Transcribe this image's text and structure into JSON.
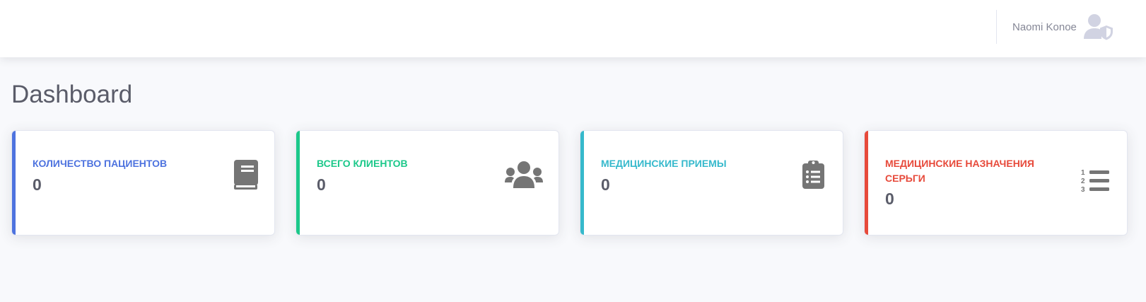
{
  "header": {
    "user_name": "Naomi Konoe",
    "user_icon": "user-shield-icon"
  },
  "page": {
    "title": "Dashboard"
  },
  "cards": [
    {
      "label": "КОЛИЧЕСТВО ПАЦИЕНТОВ",
      "value": "0",
      "color": "#4e73df",
      "icon": "book-icon"
    },
    {
      "label": "ВСЕГО КЛИЕНТОВ",
      "value": "0",
      "color": "#1cc88a",
      "icon": "users-icon"
    },
    {
      "label": "МЕДИЦИНСКИЕ ПРИЕМЫ",
      "value": "0",
      "color": "#36b9cc",
      "icon": "clipboard-list-icon"
    },
    {
      "label": "МЕДИЦИНСКИЕ НАЗНАЧЕНИЯ СЕРЬГИ",
      "value": "0",
      "color": "#e74a3b",
      "icon": "list-ol-icon"
    }
  ],
  "colors": {
    "icon_gray": "#757575",
    "text_dark": "#5a5c69",
    "background": "#f8f9fc"
  }
}
